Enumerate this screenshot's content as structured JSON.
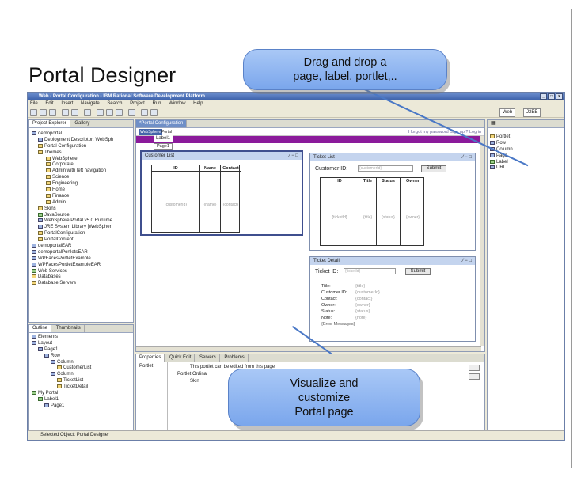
{
  "slide": {
    "title": "Portal Designer",
    "callout_drag": [
      "Drag and drop a",
      "page, label, portlet,.."
    ],
    "callout_visualize": [
      "Visualize and",
      "customize",
      "Portal page"
    ]
  },
  "window": {
    "title": "Web - Portal Configuration - IBM Rational Software Development Platform",
    "menu": [
      "File",
      "Edit",
      "Insert",
      "Navigate",
      "Search",
      "Project",
      "Run",
      "Window",
      "Help"
    ],
    "perspectives": [
      "Web",
      "J2EE"
    ],
    "status": "Selected Object: Portal Designer"
  },
  "project_explorer": {
    "tabs": [
      "Project Explorer",
      "Gallery"
    ],
    "items": [
      "demoportal",
      "Deployment Descriptor: WebSph",
      "Portal Configuration",
      "Themes",
      "WebSphere",
      "Corporate",
      "Admin with left navigation",
      "Science",
      "Engineering",
      "Home",
      "Finance",
      "Admin",
      "Skins",
      "JavaSource",
      "WebSphere Portal v5.0 Runtime",
      "JRE System Library [WebSpher",
      "PortalConfiguration",
      "PortalContent",
      "demoportalEAR",
      "demoportalPortletsEAR",
      "WPFacesPortletExample",
      "WPFacesPortletExampleEAR",
      "Web Services",
      "Databases",
      "Database Servers"
    ]
  },
  "outline": {
    "tabs": [
      "Outline",
      "Thumbnails"
    ],
    "items": [
      "Elements",
      "Layout",
      "Page1",
      "Row",
      "Column",
      "CustomerList",
      "Column",
      "TicketList",
      "TicketDetail",
      "My Portal",
      "Label1",
      "Page1"
    ]
  },
  "editor": {
    "tab": "*Portal Configuration",
    "brand": "WebSphere",
    "brand2": "Portal",
    "header_links": "I forgot my password  Sign up  ?  Log in",
    "label": "Label1",
    "page": "Page1",
    "customer_list": {
      "title": "Customer List",
      "controls": "⁄ − □",
      "columns": [
        "ID",
        "Name",
        "Contact"
      ],
      "values": [
        "{customerId}",
        "{name}",
        "{contact}"
      ]
    },
    "ticket_list": {
      "title": "Ticket List",
      "controls": "⁄ − □",
      "field_label": "Customer ID:",
      "field_value": "{customerId}",
      "submit": "Submit",
      "columns": [
        "ID",
        "Title",
        "Status",
        "Owner"
      ],
      "values": [
        "{ticketId}",
        "{title}",
        "{status}",
        "{owner}"
      ]
    },
    "ticket_detail": {
      "title": "Ticket Detail",
      "controls": "⁄ − □",
      "field_label": "Ticket ID:",
      "field_value": "{ticketId}",
      "submit": "Submit",
      "rows": [
        {
          "label": "Title:",
          "value": "{title}"
        },
        {
          "label": "Customer ID:",
          "value": "{customerId}"
        },
        {
          "label": "Contact:",
          "value": "{contact}"
        },
        {
          "label": "Owner:",
          "value": "{owner}"
        },
        {
          "label": "Status:",
          "value": "{status}"
        },
        {
          "label": "Note:",
          "value": "{note}"
        }
      ],
      "errors": "{Error Messages}"
    }
  },
  "palette": {
    "items": [
      "Portlet",
      "Row",
      "Column",
      "Page",
      "Label",
      "URL"
    ]
  },
  "properties": {
    "tabs": [
      "Properties",
      "Quick Edit",
      "Servers",
      "Problems"
    ],
    "left": "Portlet",
    "text": "This portlet can be edited from this page",
    "fields": [
      "Portlet Ordinal",
      "Skin"
    ]
  }
}
